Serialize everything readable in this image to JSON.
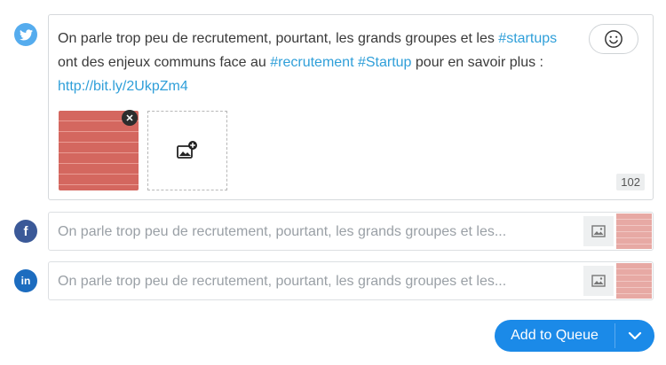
{
  "twitter": {
    "text_1": "On parle trop peu de recrutement, pourtant, les grands groupes et les ",
    "tag_1": "#startups",
    "text_2": " ont des enjeux communs face au ",
    "tag_2": "#recrutement",
    "text_3": " ",
    "tag_3": "#Startup",
    "text_4": " pour en savoir plus : ",
    "link": "http://bit.ly/2UkpZm4",
    "char_count": "102",
    "icons": {
      "network": "twitter-icon",
      "emoji": "smiley-icon",
      "remove": "close-icon",
      "add_media": "add-image-icon"
    }
  },
  "facebook": {
    "placeholder_text": "On parle trop peu de recrutement, pourtant, les grands groupes et les...",
    "icons": {
      "network": "facebook-icon",
      "media": "image-icon"
    }
  },
  "linkedin": {
    "placeholder_text": "On parle trop peu de recrutement, pourtant, les grands groupes et les...",
    "icons": {
      "network": "linkedin-icon",
      "media": "image-icon"
    }
  },
  "actions": {
    "add_to_queue": "Add to Queue",
    "dropdown_icon": "chevron-down-icon"
  },
  "colors": {
    "twitter": "#55acee",
    "facebook": "#3b5998",
    "linkedin": "#1c6cbf",
    "accent": "#1b8ae8",
    "hashtag": "#2f9fd9"
  }
}
